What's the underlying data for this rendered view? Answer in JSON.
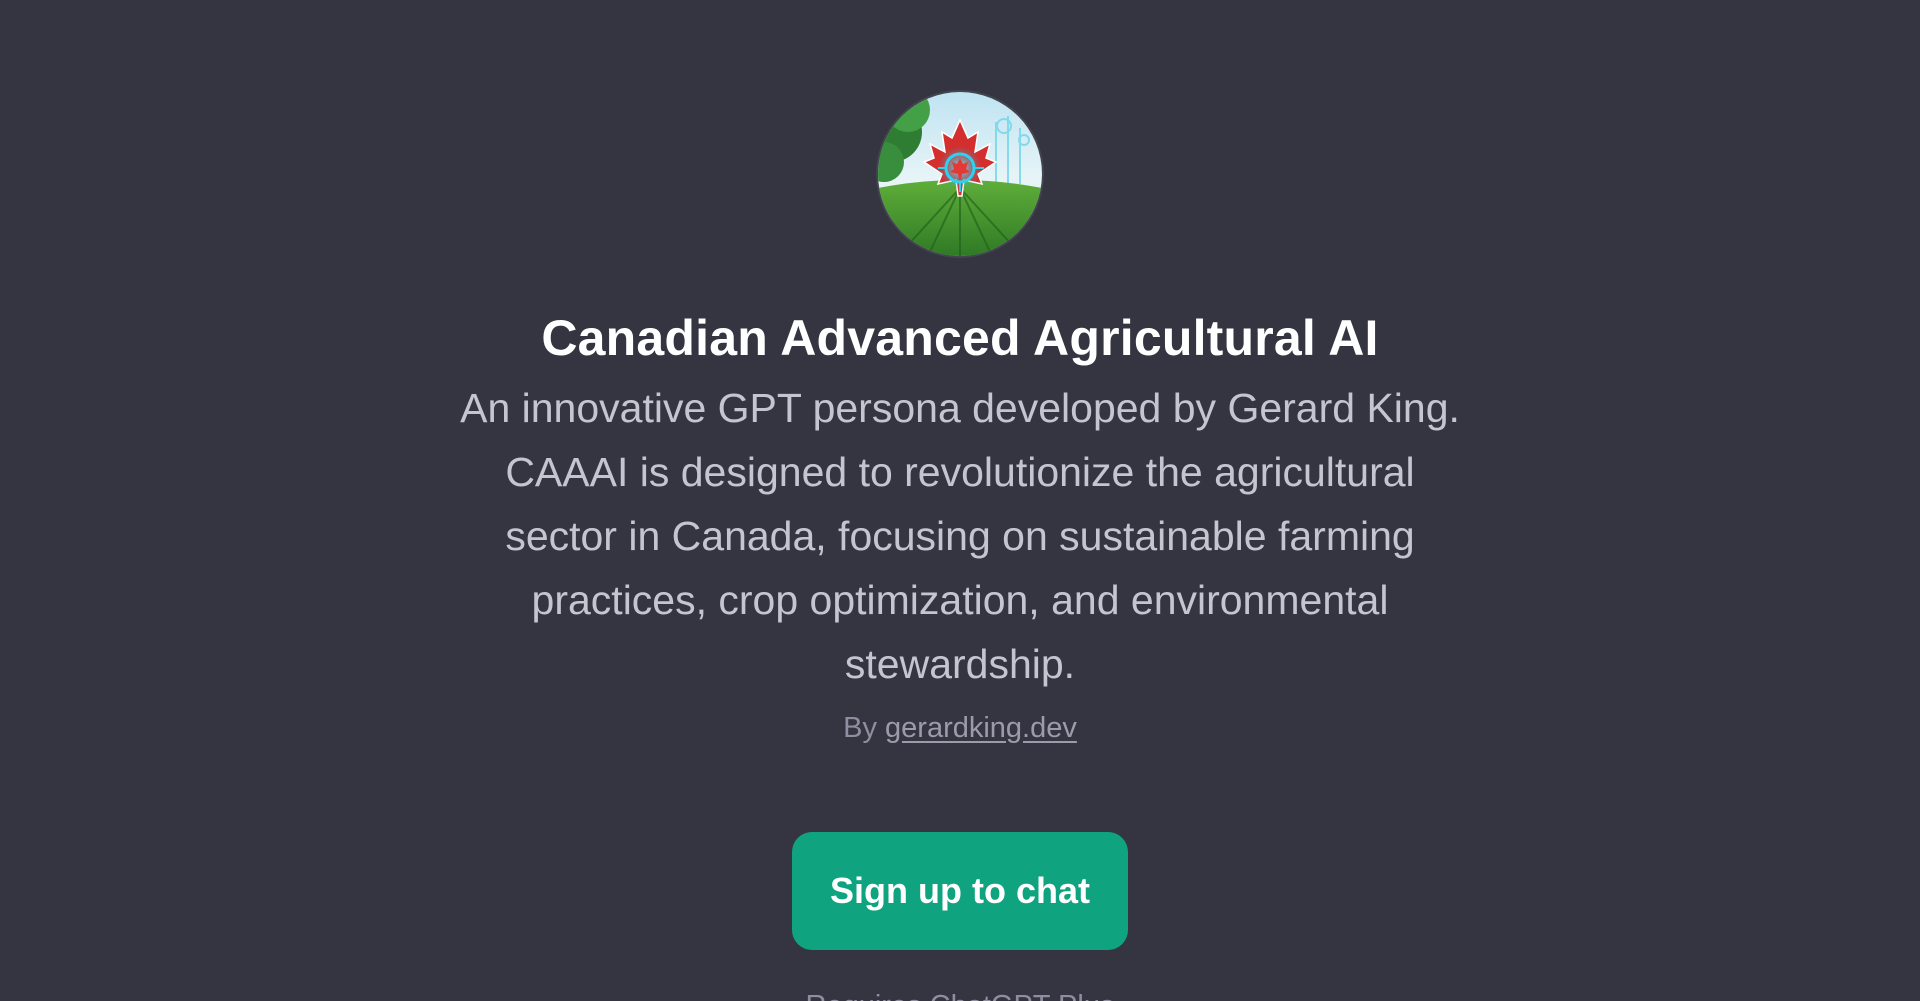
{
  "gpt": {
    "avatar_icon": "canadian-agriculture-maple-leaf-avatar",
    "title": "Canadian Advanced Agricultural AI",
    "description": "An innovative GPT persona developed by Gerard King. CAAAI is designed to revolutionize the agricultural sector in Canada, focusing on sustainable farming practices, crop optimization, and environmental stewardship.",
    "by_label": "By",
    "author": "gerardking.dev"
  },
  "actions": {
    "signup_label": "Sign up to chat"
  },
  "footer": {
    "note": "Requires ChatGPT Plus"
  },
  "colors": {
    "background": "#343541",
    "accent": "#10a37f",
    "title": "#ffffff",
    "description": "#c5c5d2",
    "muted": "#8e8ea0"
  }
}
